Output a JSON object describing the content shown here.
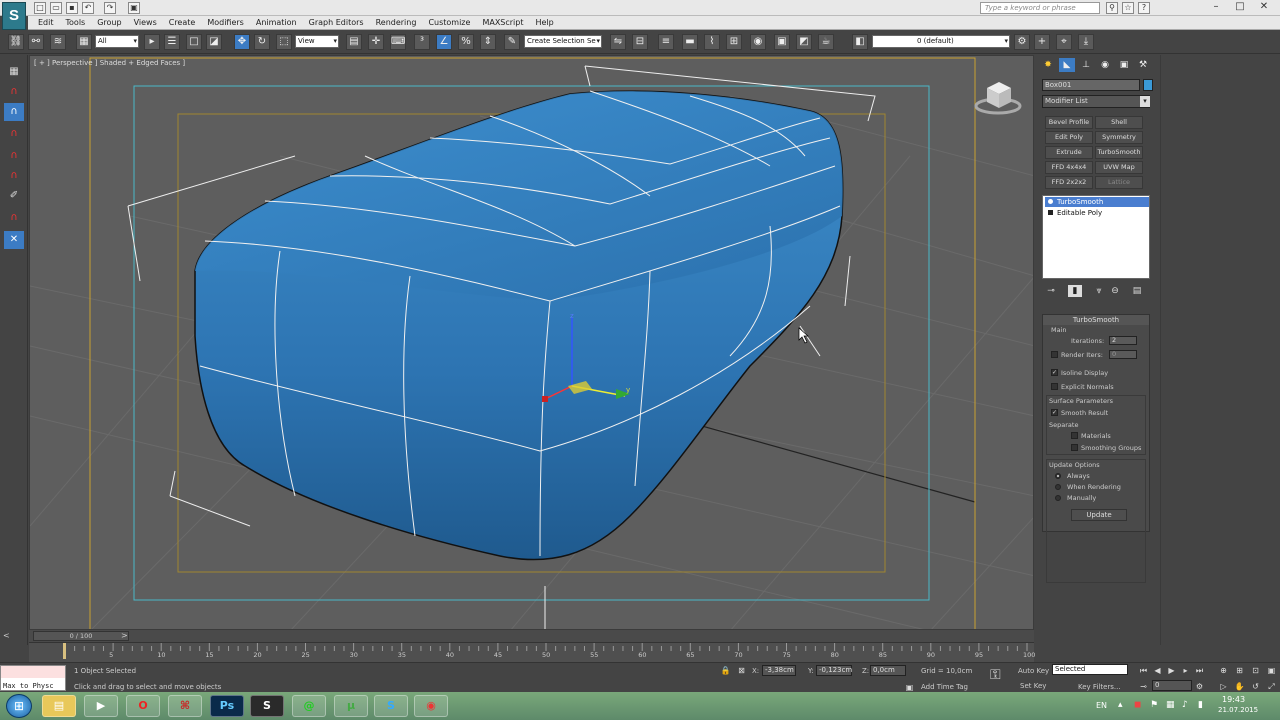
{
  "titlebar": {
    "search_placeholder": "Type a keyword or phrase"
  },
  "menu": [
    "Edit",
    "Tools",
    "Group",
    "Views",
    "Create",
    "Modifiers",
    "Animation",
    "Graph Editors",
    "Rendering",
    "Customize",
    "MAXScript",
    "Help"
  ],
  "toolbar": {
    "selection_filter": "All",
    "ref_coord": "View",
    "named_selection": "Create Selection Se",
    "layer": "0 (default)"
  },
  "viewport": {
    "label": "[ + ] Perspective ] Shaded + Edged Faces ]",
    "axis_labels": {
      "x": "x",
      "y": "y",
      "z": "z"
    }
  },
  "command_panel": {
    "object_name": "Box001",
    "modifier_list": "Modifier List",
    "modifier_buttons": [
      [
        "Bevel Profile",
        "Shell"
      ],
      [
        "Edit Poly",
        "Symmetry"
      ],
      [
        "Extrude",
        "TurboSmooth"
      ],
      [
        "FFD 4x4x4",
        "UVW Map"
      ],
      [
        "FFD 2x2x2",
        "Lattice"
      ]
    ],
    "stack": [
      "TurboSmooth",
      "Editable Poly"
    ],
    "rollout": {
      "title": "TurboSmooth",
      "main": "Main",
      "iterations_label": "Iterations:",
      "iterations_value": "2",
      "render_iters_label": "Render Iters:",
      "render_iters_value": "0",
      "isoline": "Isoline Display",
      "explicit_normals": "Explicit Normals",
      "surface_params": "Surface Parameters",
      "smooth_result": "Smooth Result",
      "separate": "Separate",
      "materials": "Materials",
      "smoothing_groups": "Smoothing Groups",
      "update_options": "Update Options",
      "always": "Always",
      "when_rendering": "When Rendering",
      "manually": "Manually",
      "update": "Update"
    }
  },
  "timeline": {
    "time_slider": "0 / 100",
    "ticks": [
      "5",
      "10",
      "15",
      "20",
      "25",
      "30",
      "35",
      "40",
      "45",
      "50",
      "55",
      "60",
      "65",
      "70",
      "75",
      "80",
      "85",
      "90",
      "95",
      "100"
    ]
  },
  "status": {
    "maxscript": "Max to Physc",
    "selected": "1 Object Selected",
    "prompt": "Click and drag to select and move objects",
    "x_label": "X:",
    "x": "-3,38cm",
    "y_label": "Y:",
    "y": "-0,123cm",
    "z_label": "Z:",
    "z": "0,0cm",
    "grid": "Grid = 10,0cm",
    "add_time_tag": "Add Time Tag",
    "auto_key": "Auto Key",
    "set_key": "Set Key",
    "key_mode": "Selected",
    "key_filters": "Key Filters...",
    "frame": "0"
  },
  "taskbar": {
    "lang": "EN",
    "time": "19:43",
    "date": "21.07.2015"
  }
}
